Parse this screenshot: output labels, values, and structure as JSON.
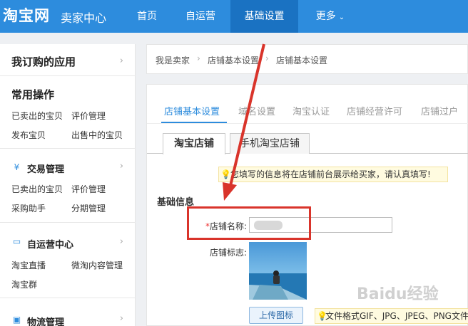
{
  "header": {
    "logo": "淘宝网",
    "subtitle": "卖家中心",
    "nav": [
      {
        "label": "首页"
      },
      {
        "label": "自运营"
      },
      {
        "label": "基础设置"
      },
      {
        "label": "更多"
      }
    ],
    "active_nav": "基础设置"
  },
  "sidebar": {
    "my_apps": "我订购的应用",
    "common": {
      "title": "常用操作",
      "links": [
        "已卖出的宝贝",
        "评价管理",
        "发布宝贝",
        "出售中的宝贝"
      ]
    },
    "trade": {
      "title": "交易管理",
      "links": [
        "已卖出的宝贝",
        "评价管理",
        "采购助手",
        "分期管理"
      ]
    },
    "self_op": {
      "title": "自运营中心",
      "links": [
        "淘宝直播",
        "微淘内容管理",
        "淘宝群"
      ]
    },
    "logistics": {
      "title": "物流管理"
    }
  },
  "breadcrumb": [
    "我是卖家",
    "店铺基本设置",
    "店铺基本设置"
  ],
  "tabs": [
    "店铺基本设置",
    "域名设置",
    "淘宝认证",
    "店铺经营许可",
    "店铺过户"
  ],
  "active_tab": "店铺基本设置",
  "subtabs": [
    "淘宝店铺",
    "手机淘宝店铺"
  ],
  "notice": "您填写的信息将在店铺前台展示给买家，请认真填写!",
  "section_title": "基础信息",
  "shop_name_label": "店铺名称:",
  "shop_logo_label": "店铺标志:",
  "upload_label": "上传图标",
  "format_hint": "文件格式GIF、JPG、JPEG、PNG文件",
  "watermark": "Baidu经验",
  "colors": {
    "brand_blue": "#2d8cdd",
    "highlight_red": "#d9342b"
  }
}
